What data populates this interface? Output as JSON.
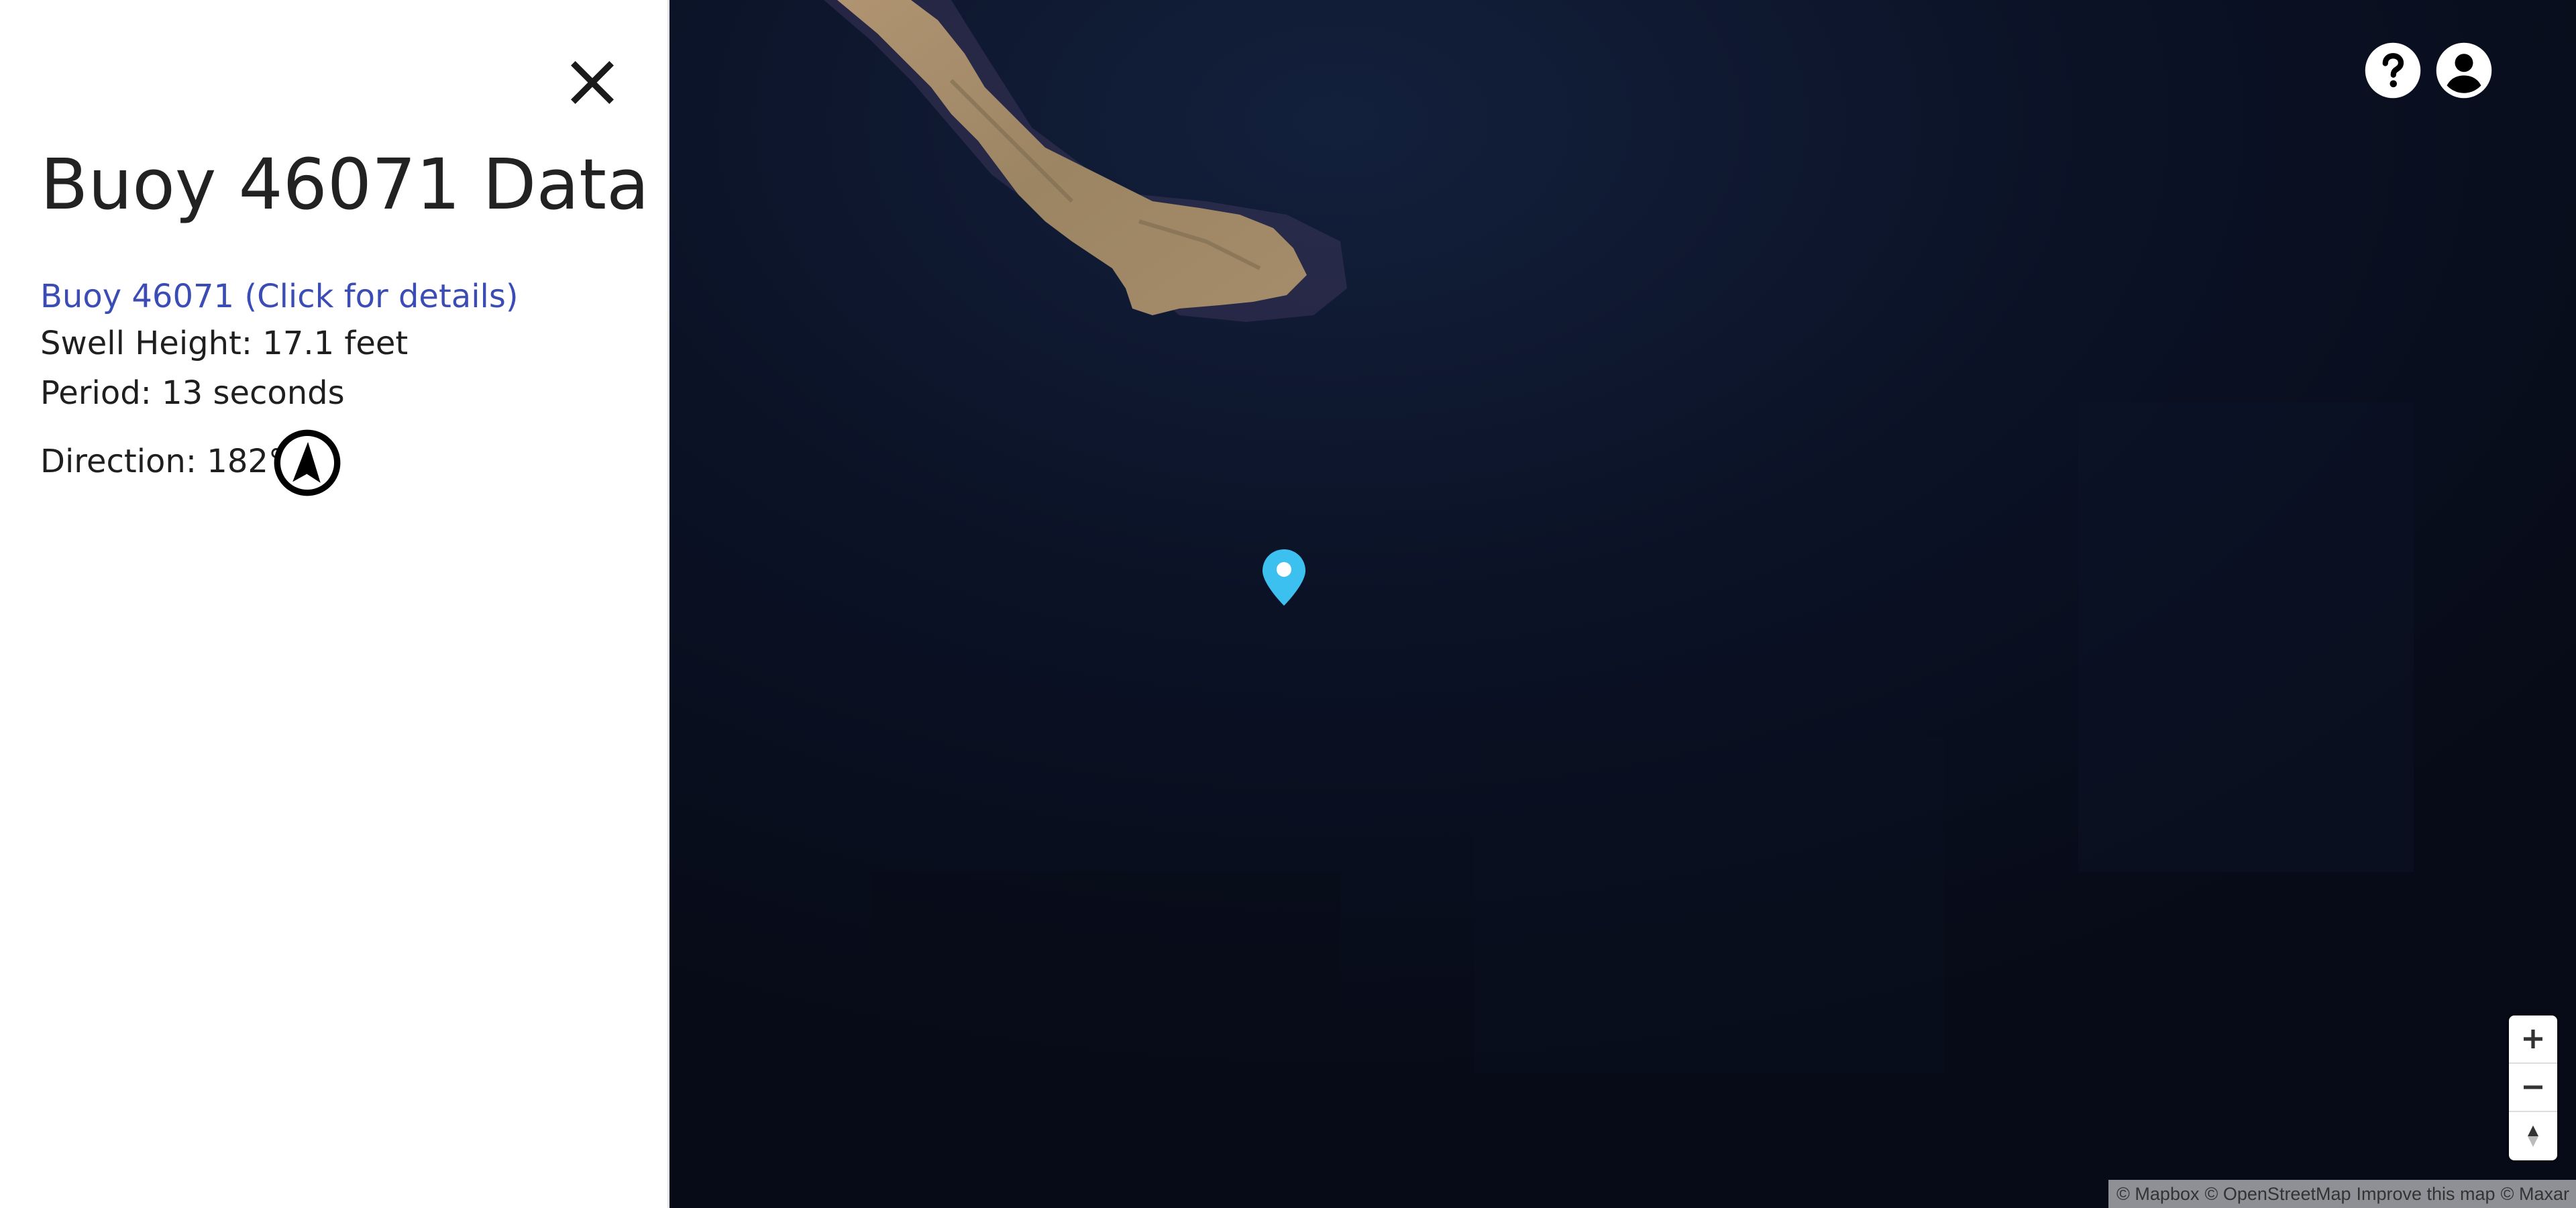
{
  "panel": {
    "title": "Buoy 46071 Data",
    "link_text": "Buoy 46071 (Click for details)",
    "swell_height": "Swell Height: 17.1 feet",
    "period": "Period: 13 seconds",
    "direction": "Direction: 182°",
    "direction_degrees": 182,
    "close_icon": "close-icon",
    "compass_icon": "compass-arrow-icon"
  },
  "map": {
    "marker_icon": "location-pin-icon",
    "marker_color": "#3cc0ef",
    "help_icon": "help-circle-icon",
    "account_icon": "account-circle-icon",
    "zoom_in_icon": "plus-icon",
    "zoom_out_icon": "minus-icon",
    "reset_north_icon": "compass-north-icon",
    "attribution": {
      "mapbox": "© Mapbox",
      "osm": "© OpenStreetMap",
      "improve": "Improve this map",
      "maxar": "© Maxar"
    }
  },
  "colors": {
    "link": "#3b4db5",
    "ocean": "#0b1226",
    "land": "#a48a66"
  }
}
